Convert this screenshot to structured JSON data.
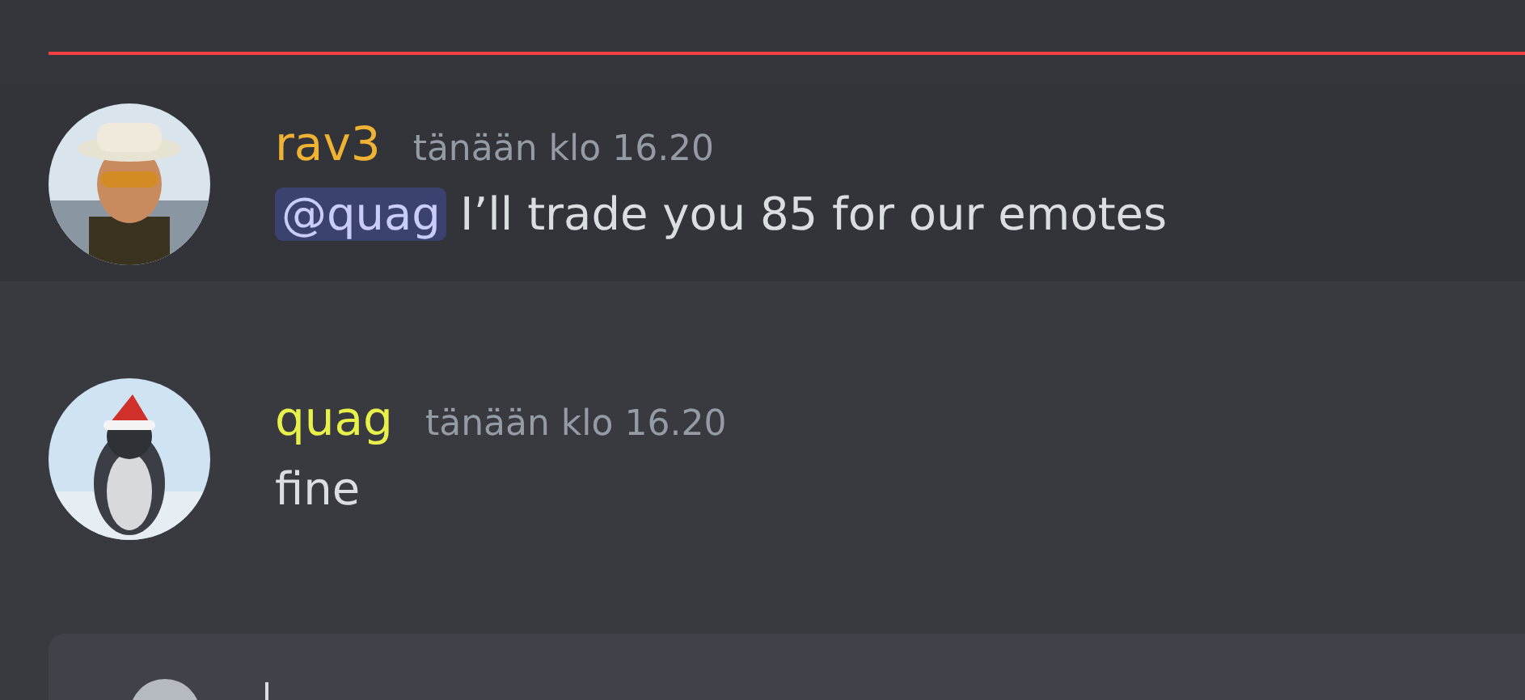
{
  "new_messages_divider": {
    "color": "#f23f43"
  },
  "messages": [
    {
      "author": "rav3",
      "color": "#f0b232",
      "timestamp": "tänään klo 16.20",
      "mentioned": true,
      "mention": "@quag",
      "text": "I’ll trade you 85 for our emotes"
    },
    {
      "author": "quag",
      "color": "#e8f04a",
      "timestamp": "tänään klo 16.20",
      "text": "fine"
    }
  ],
  "composer": {
    "focused": true
  }
}
